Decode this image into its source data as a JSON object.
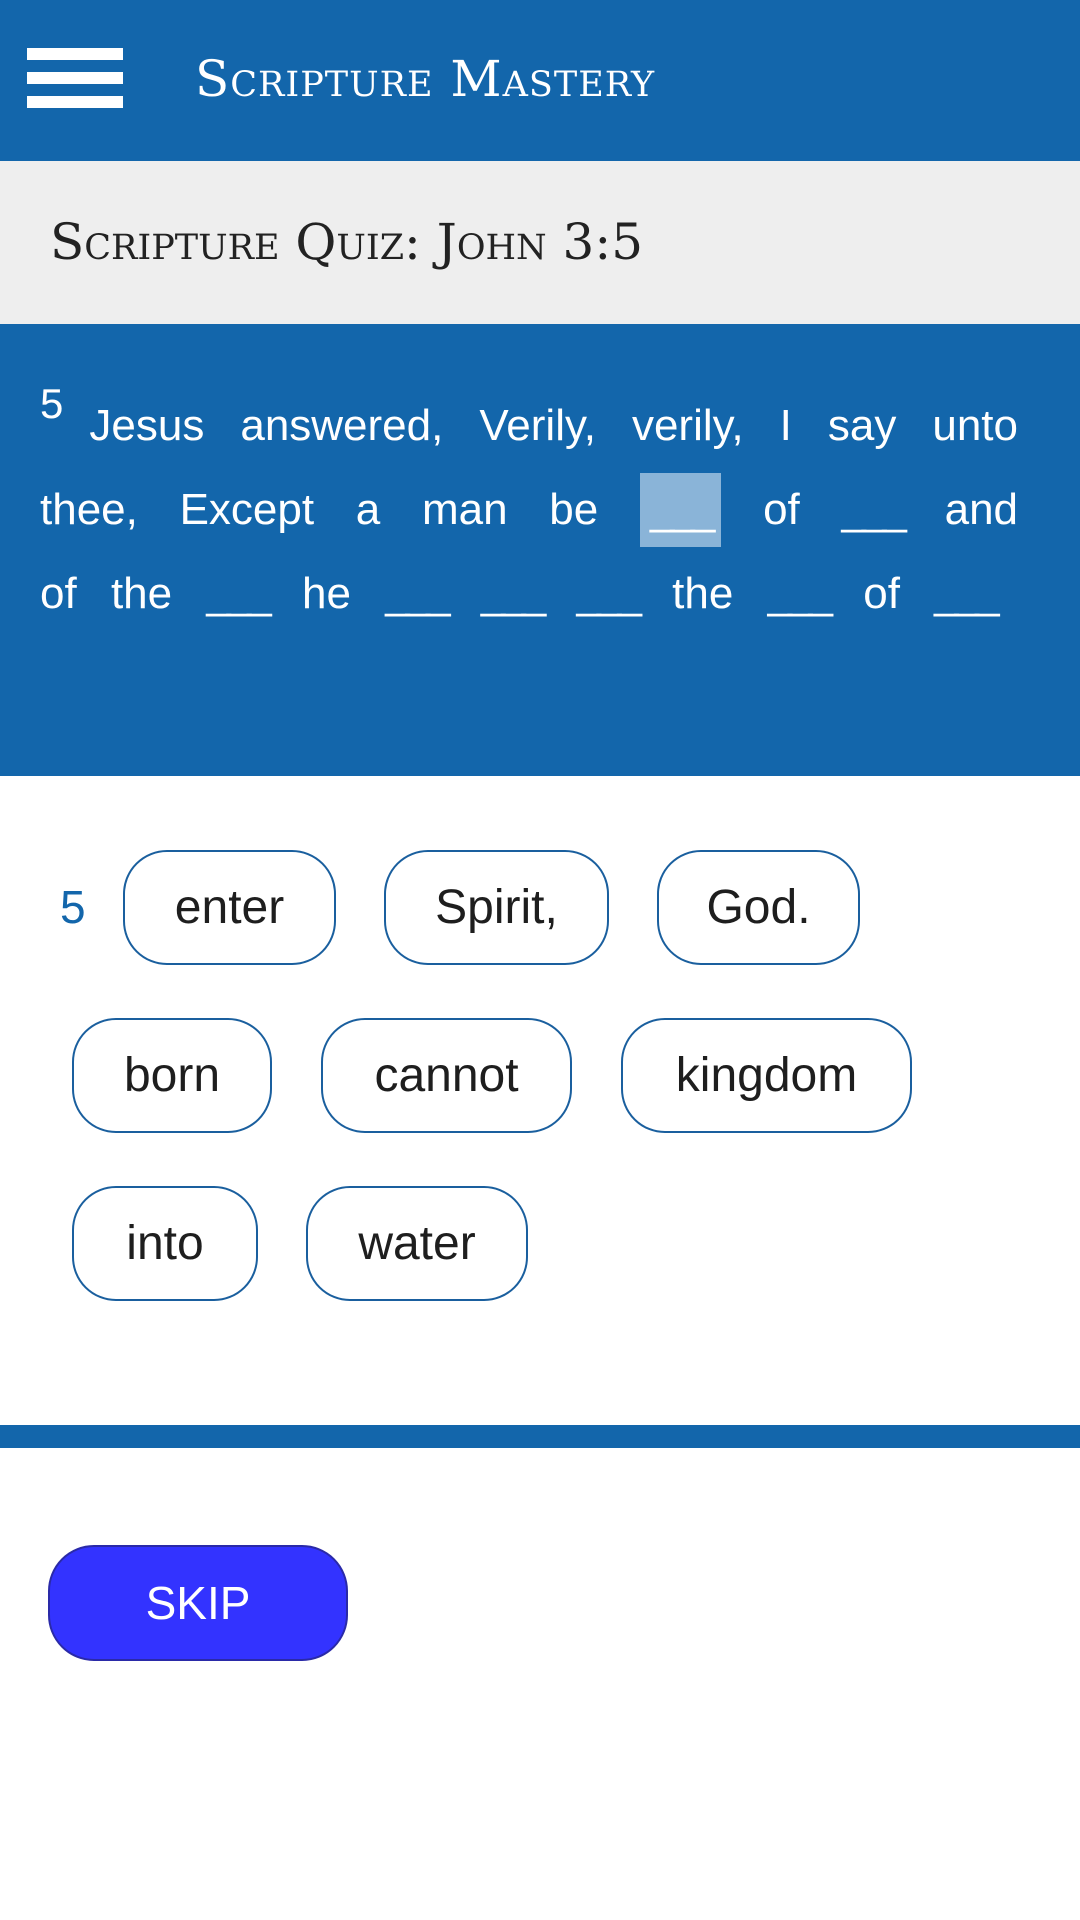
{
  "header": {
    "title": "Scripture Mastery",
    "menu_icon": "hamburger-menu-icon"
  },
  "quiz": {
    "title": "Scripture Quiz: John 3:5"
  },
  "verse": {
    "number": "5",
    "line_tokens": [
      "Jesus",
      "answered,",
      "Verily,",
      "verily,",
      "I",
      "say",
      "unto",
      "thee,",
      "Except",
      "a",
      "man",
      "be",
      "___",
      "of",
      "___",
      "and",
      "of",
      "the",
      "___",
      "he",
      "___",
      "___",
      "___",
      "the",
      "___",
      "of",
      "___"
    ],
    "active_blank_index": 12
  },
  "word_bank": {
    "verse_number": "5",
    "words": [
      "enter",
      "Spirit,",
      "God.",
      "born",
      "cannot",
      "kingdom",
      "into",
      "water"
    ]
  },
  "actions": {
    "skip_label": "SKIP"
  },
  "colors": {
    "primary": "#1366ab",
    "band_gray": "#eeeeee",
    "skip_button": "#3333ff",
    "active_blank": "#8ab4d8"
  }
}
